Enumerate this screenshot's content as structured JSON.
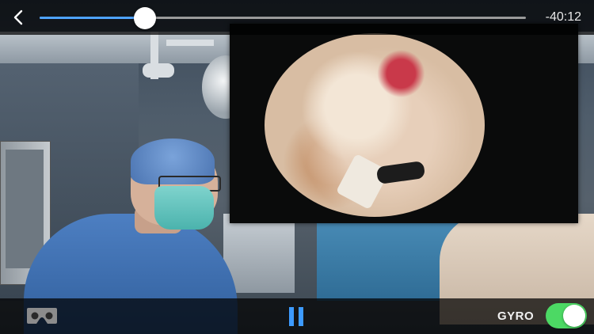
{
  "player": {
    "back_icon": "chevron-left-icon",
    "time_remaining": "-40:12",
    "progress": 0.216,
    "accent_color": "#4ea3ff"
  },
  "controls": {
    "vr_icon": "vr-headset-icon",
    "play_state": "playing",
    "pause_icon": "pause-icon",
    "gyro_label": "GYRO",
    "gyro_enabled": true,
    "toggle_on_color": "#4cd964"
  }
}
